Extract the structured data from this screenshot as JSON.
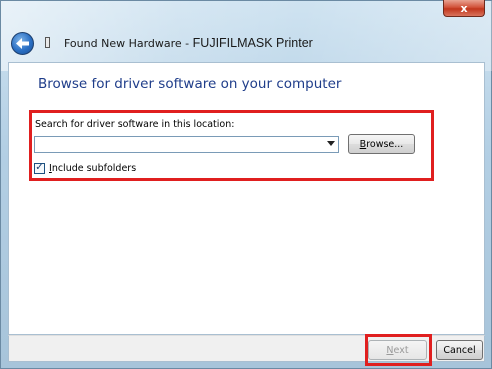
{
  "window": {
    "title_prefix": "Found New Hardware - ",
    "title_app": "FUJIFILMASK Printer",
    "close_glyph": "x"
  },
  "page": {
    "heading": "Browse for driver software on your computer",
    "search_label": "Search for driver software in this location:",
    "location": {
      "value": "",
      "placeholder": ""
    },
    "browse_button": "rowse...",
    "browse_accel": "B",
    "include_subfolders": {
      "label_accel": "I",
      "label_rest": "nclude subfolders",
      "checked": true
    }
  },
  "footer": {
    "next_accel": "N",
    "next_rest": "ext",
    "cancel_label": "Cancel"
  },
  "icons": [
    "back-arrow-icon",
    "hardware-icon",
    "dropdown-arrow-icon",
    "close-icon",
    "checkmark-icon"
  ],
  "colors": {
    "highlight": "#e01f1f",
    "heading": "#1f3d8a"
  }
}
